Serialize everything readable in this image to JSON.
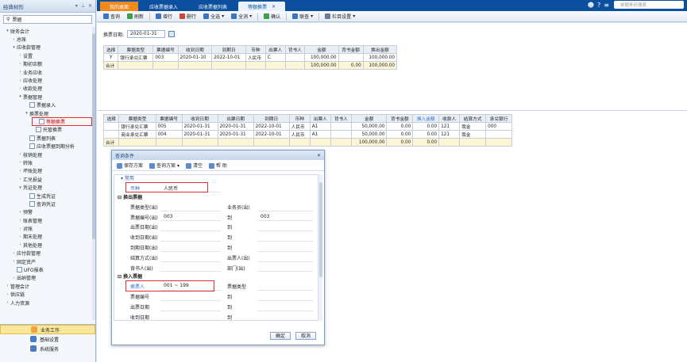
{
  "sidebar": {
    "title": "经典树形",
    "search_value": "票据",
    "items": [
      {
        "label": "财务会计",
        "level": 0,
        "exp": "▾"
      },
      {
        "label": "总账",
        "level": 1,
        "exp": "›"
      },
      {
        "label": "应收款管理",
        "level": 1,
        "exp": "▾"
      },
      {
        "label": "设置",
        "level": 2,
        "exp": "›"
      },
      {
        "label": "期初余额",
        "level": 2,
        "exp": "›"
      },
      {
        "label": "业务应收",
        "level": 2,
        "exp": "›"
      },
      {
        "label": "应收处理",
        "level": 2,
        "exp": "›"
      },
      {
        "label": "收款处理",
        "level": 2,
        "exp": "›"
      },
      {
        "label": "票据管理",
        "level": 2,
        "exp": "▾"
      },
      {
        "label": "票据录入",
        "level": 3,
        "exp": "",
        "icon": true
      },
      {
        "label": "换票处理",
        "level": 3,
        "exp": "▾"
      },
      {
        "label": "等额换票",
        "level": 4,
        "exp": "",
        "icon": true,
        "sel": true
      },
      {
        "label": "托管换票",
        "level": 4,
        "exp": "",
        "icon": true
      },
      {
        "label": "票据列表",
        "level": 3,
        "exp": "",
        "icon": true
      },
      {
        "label": "应收票据到期分析",
        "level": 3,
        "exp": "",
        "icon": true
      },
      {
        "label": "核销处理",
        "level": 2,
        "exp": "›"
      },
      {
        "label": "转账",
        "level": 2,
        "exp": "›"
      },
      {
        "label": "坏账处理",
        "level": 2,
        "exp": "›"
      },
      {
        "label": "汇兑损益",
        "level": 2,
        "exp": "›"
      },
      {
        "label": "凭证处理",
        "level": 2,
        "exp": "▾"
      },
      {
        "label": "生成凭证",
        "level": 3,
        "exp": "",
        "icon": true
      },
      {
        "label": "查询凭证",
        "level": 3,
        "exp": "",
        "icon": true
      },
      {
        "label": "预警",
        "level": 2,
        "exp": "›"
      },
      {
        "label": "账表管理",
        "level": 2,
        "exp": "›"
      },
      {
        "label": "对账",
        "level": 2,
        "exp": "›"
      },
      {
        "label": "期末处理",
        "level": 2,
        "exp": "›"
      },
      {
        "label": "其他处理",
        "level": 2,
        "exp": "›"
      },
      {
        "label": "应付款管理",
        "level": 1,
        "exp": "›"
      },
      {
        "label": "固定资产",
        "level": 1,
        "exp": "›"
      },
      {
        "label": "UFO报表",
        "level": 1,
        "exp": "",
        "icon": true
      },
      {
        "label": "出纳管理",
        "level": 1,
        "exp": "›"
      },
      {
        "label": "管理会计",
        "level": 0,
        "exp": "›"
      },
      {
        "label": "供应链",
        "level": 0,
        "exp": "›"
      },
      {
        "label": "人力资源",
        "level": 0,
        "exp": "›"
      }
    ],
    "bottom": [
      {
        "label": "业务工作",
        "active": true
      },
      {
        "label": "基础设置",
        "active": false
      },
      {
        "label": "系统服务",
        "active": false
      }
    ]
  },
  "tabs": [
    "我的桌面",
    "应收票据录入",
    "应收票据列表",
    "等额换票"
  ],
  "search_placeholder": "单据条码搜索",
  "toolbar": [
    {
      "label": "查询",
      "color": "#3b74c7",
      "drop": false
    },
    {
      "label": "刷新",
      "color": "#3aa14a",
      "drop": false
    },
    {
      "label": "增行",
      "color": "#3b74c7",
      "drop": false
    },
    {
      "label": "删行",
      "color": "#d0453a",
      "drop": false
    },
    {
      "label": "全选",
      "color": "#3b74c7",
      "drop": true
    },
    {
      "label": "全消",
      "color": "#3b74c7",
      "drop": true
    },
    {
      "label": "确认",
      "color": "#3aa14a",
      "drop": false
    },
    {
      "label": "联查",
      "color": "#3b74c7",
      "drop": true
    },
    {
      "label": "栏目设置",
      "color": "#6b7d93",
      "drop": true
    }
  ],
  "date_label": "换票日期:",
  "date_value": "2020-01-31",
  "top_table": {
    "headers": [
      "选择",
      "票据类型",
      "票据编号",
      "收到日期",
      "到期日",
      "币种",
      "出票人",
      "背书人",
      "金额",
      "背书金额",
      "换出金额"
    ],
    "rows": [
      [
        "Y",
        "银行承兑汇票",
        "003",
        "2020-01-10",
        "2022-10-01",
        "人民币",
        "C",
        "",
        "100,000.00",
        "",
        "100,000.00"
      ]
    ],
    "sum": [
      "合计",
      "",
      "",
      "",
      "",
      "",
      "",
      "",
      "100,000.00",
      "0.00",
      "100,000.00"
    ]
  },
  "bottom_table": {
    "headers": [
      "选择",
      "票据类型",
      "票据编号",
      "收到日期",
      "出票日期",
      "到期日",
      "币种",
      "出票人",
      "背书人",
      "金额",
      "背书金额",
      "换入金额",
      "收款人",
      "结算方式",
      "承兑银行"
    ],
    "rows": [
      [
        "",
        "银行承兑汇票",
        "005",
        "2020-01-31",
        "2020-01-31",
        "2022-10-01",
        "人民币",
        "A1",
        "",
        "50,000.00",
        "0.00",
        "0.00",
        "121",
        "我金",
        "000"
      ],
      [
        "",
        "商业承兑汇票",
        "004",
        "2020-01-31",
        "2020-01-31",
        "2022-10-01",
        "人民币",
        "A1",
        "",
        "50,000.00",
        "0.00",
        "0.00",
        "121",
        "我金",
        ""
      ]
    ],
    "sum": [
      "合计",
      "",
      "",
      "",
      "",
      "",
      "",
      "",
      "",
      "100,000.00",
      "0.00",
      "0.00",
      "",
      "",
      ""
    ]
  },
  "dialog": {
    "title": "查询条件",
    "tools": [
      "保存方案",
      "查询方案",
      "清空",
      "帮 助"
    ],
    "section": "常用",
    "currency_label": "币种",
    "currency_value": "人民币",
    "group_out": "换出票据",
    "out_fields": [
      {
        "l": "票据类型(出)",
        "v": "",
        "r": "业务员(出)",
        "rv": ""
      },
      {
        "l": "票据编号(出)",
        "v": "003",
        "r": "到",
        "rv": "003"
      },
      {
        "l": "出票日期(出)",
        "v": "",
        "r": "到",
        "rv": ""
      },
      {
        "l": "收到日期(出)",
        "v": "",
        "r": "到",
        "rv": ""
      },
      {
        "l": "到期日期(出)",
        "v": "",
        "r": "到",
        "rv": ""
      },
      {
        "l": "结算方式(出)",
        "v": "",
        "r": "出票人(出)",
        "rv": ""
      },
      {
        "l": "背书人(出)",
        "v": "",
        "r": "部门(出)",
        "rv": ""
      }
    ],
    "group_in": "换入票据",
    "payee_label": "换票人",
    "payee_value": "001 ~ 199",
    "in_fields_right": "票据类型",
    "in_fields": [
      {
        "l": "票据编号",
        "r": "到"
      },
      {
        "l": "出票日期",
        "r": "到"
      },
      {
        "l": "收到日期",
        "r": "到"
      },
      {
        "l": "结算方式",
        "r": "出票人"
      }
    ],
    "ok": "确定",
    "cancel": "取消"
  }
}
